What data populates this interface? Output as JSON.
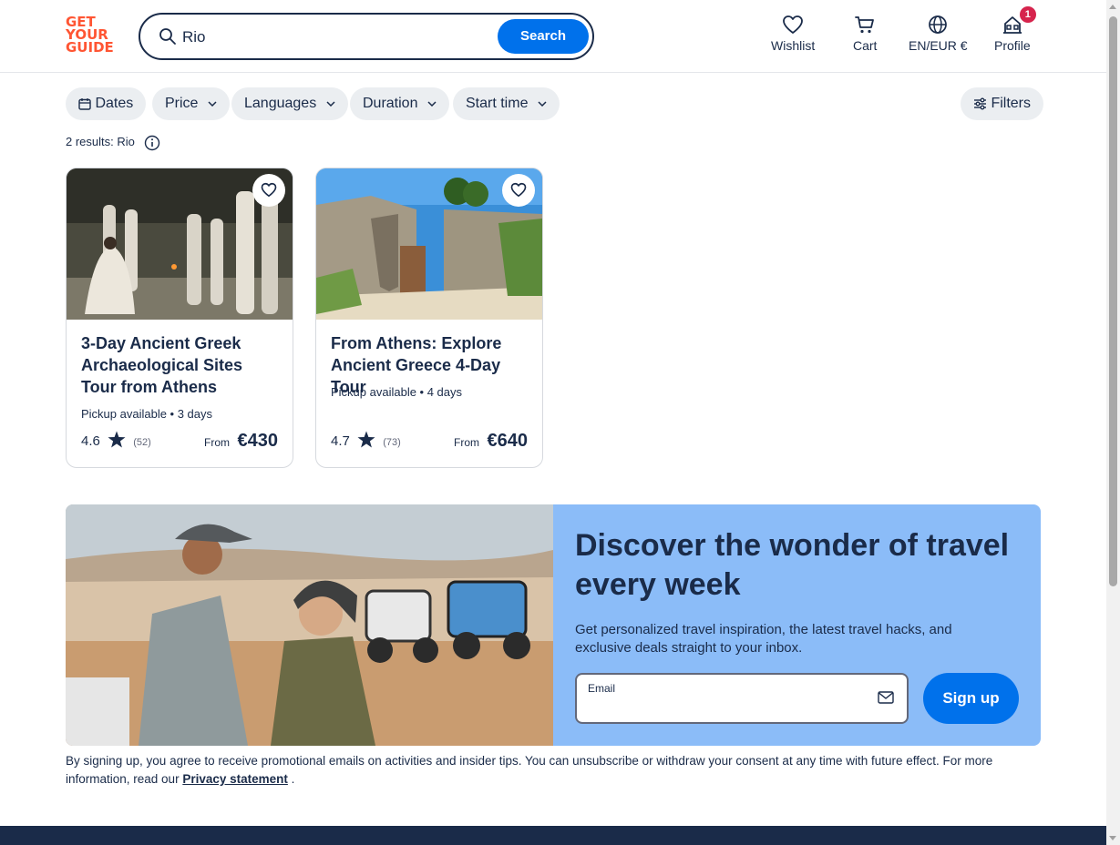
{
  "header": {
    "logo_lines": [
      "GET",
      "YOUR",
      "GUIDE"
    ],
    "search": {
      "value": "Rio",
      "button_label": "Search"
    },
    "nav": {
      "wishlist": "Wishlist",
      "cart": "Cart",
      "locale": "EN/EUR €",
      "profile": "Profile",
      "profile_badge": "1"
    }
  },
  "filters": {
    "dates": "Dates",
    "price": "Price",
    "languages": "Languages",
    "duration": "Duration",
    "start_time": "Start time",
    "more": "Filters"
  },
  "results_text": "2 results: Rio",
  "cards": [
    {
      "title": "3-Day Ancient Greek Archaeological Sites Tour from Athens",
      "meta": "Pickup available • 3 days",
      "rating": "4.6",
      "reviews": "(52)",
      "from_label": "From",
      "price": "€430",
      "image_icon": "ceremony-photo"
    },
    {
      "title": "From Athens: Explore Ancient Greece 4-Day Tour",
      "meta": "Pickup available • 4 days",
      "rating": "4.7",
      "reviews": "(73)",
      "from_label": "From",
      "price": "€640",
      "image_icon": "ruins-photo"
    }
  ],
  "newsletter": {
    "title": "Discover the wonder of travel every week",
    "text": "Get personalized travel inspiration, the latest travel hacks, and exclusive deals straight to your inbox.",
    "email_label": "Email",
    "email_value": "",
    "signup_label": "Sign up",
    "image_icon": "desert-buggy-photo"
  },
  "disclaimer": {
    "text": "By signing up, you agree to receive promotional emails on activities and insider tips. You can unsubscribe or withdraw your consent at any time with future effect. For more information, read our ",
    "link": "Privacy statement",
    "suffix": " ."
  },
  "colors": {
    "brand": "#ff5533",
    "primary": "#0071eb",
    "navy": "#1a2b49",
    "banner_bg": "#8bbcf8",
    "badge": "#d6244d"
  }
}
